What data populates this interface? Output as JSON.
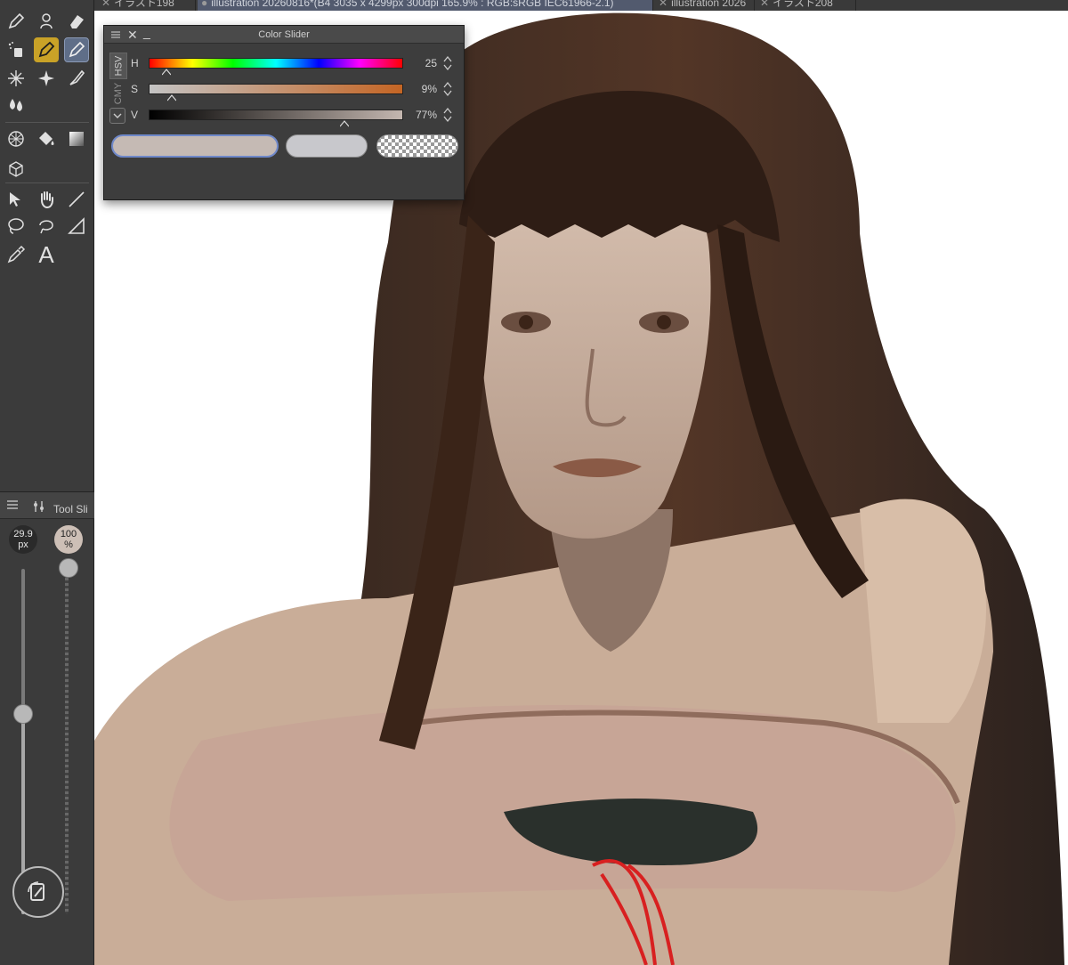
{
  "tabs": [
    {
      "label": "イラスト198",
      "active": false
    },
    {
      "label": "illustration 20260816*(B4 3035 x 4299px 300dpi 165.9% : RGB:sRGB IEC61966-2.1)",
      "active": true
    },
    {
      "label": "illustration 2026",
      "active": false
    },
    {
      "label": "イラスト208",
      "active": false
    }
  ],
  "tab_close_glyph": "✕",
  "toolbox": {
    "tools": [
      {
        "name": "pen-icon"
      },
      {
        "name": "figure-icon"
      },
      {
        "name": "eraser-icon"
      },
      {
        "name": "airbrush-icon"
      },
      {
        "name": "g-pen-icon",
        "selected": "yellow"
      },
      {
        "name": "marker-icon",
        "selected": "blue"
      },
      {
        "name": "magic-wand-icon"
      },
      {
        "name": "sparkle-icon"
      },
      {
        "name": "brush-icon"
      },
      {
        "name": "blend-icon"
      },
      {
        "name": "perspective-ruler-icon"
      },
      {
        "name": "fill-icon"
      },
      {
        "name": "gradient-icon"
      },
      {
        "name": "3d-object-icon"
      },
      {
        "name": "move-layer-icon"
      },
      {
        "name": "hand-icon"
      },
      {
        "name": "line-icon"
      },
      {
        "name": "lasso-icon"
      },
      {
        "name": "select-lasso-icon"
      },
      {
        "name": "ruler-icon"
      },
      {
        "name": "eyedropper-icon"
      },
      {
        "name": "text-tool-icon"
      }
    ],
    "text_tool_glyph": "A"
  },
  "tool_slider": {
    "title": "Tool Sli",
    "size": {
      "value": "29.9",
      "unit": "px"
    },
    "opacity": {
      "value": "100",
      "unit": "%"
    }
  },
  "color_slider": {
    "title": "Color Slider",
    "close_glyph": "✕",
    "minimize_glyph": "_",
    "tabs": {
      "hsv": "HSV",
      "cmy": "CMY"
    },
    "rows": {
      "h": {
        "label": "H",
        "value": "25",
        "fraction": 0.069
      },
      "s": {
        "label": "S",
        "value": "9%",
        "fraction": 0.09
      },
      "v": {
        "label": "V",
        "value": "77%",
        "fraction": 0.77
      }
    },
    "main_color": "#c5bab4",
    "sub_color": "#c8c8cc"
  },
  "colors": {
    "accent": "#6f88c9",
    "tool_selected_yellow": "#c9a227",
    "tool_selected_blue": "#5f6e88"
  }
}
